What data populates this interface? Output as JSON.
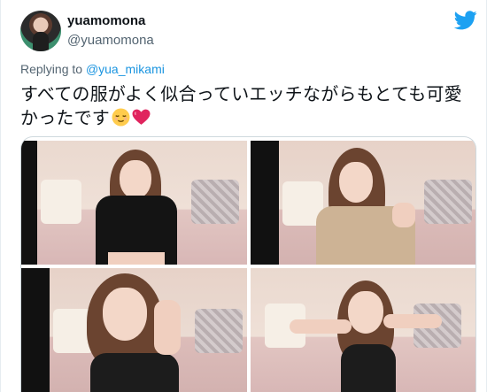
{
  "user": {
    "display_name": "yuamomona",
    "handle": "@yuamomona"
  },
  "reply": {
    "prefix": "Replying to ",
    "to": "@yua_mikami"
  },
  "tweet": {
    "text_line1": "すべての服がよく似合っていエッチながらもとても可愛",
    "text_line2": "かったです"
  },
  "icons": {
    "brand": "twitter-bird-icon",
    "emoji1": "relieved-face-emoji",
    "emoji2": "red-heart-emoji"
  },
  "colors": {
    "twitter_blue": "#1da1f2",
    "link_blue": "#1b95e0",
    "secondary_text": "#536471",
    "heart_red": "#e0245e"
  },
  "media": {
    "photo_count": 4
  }
}
